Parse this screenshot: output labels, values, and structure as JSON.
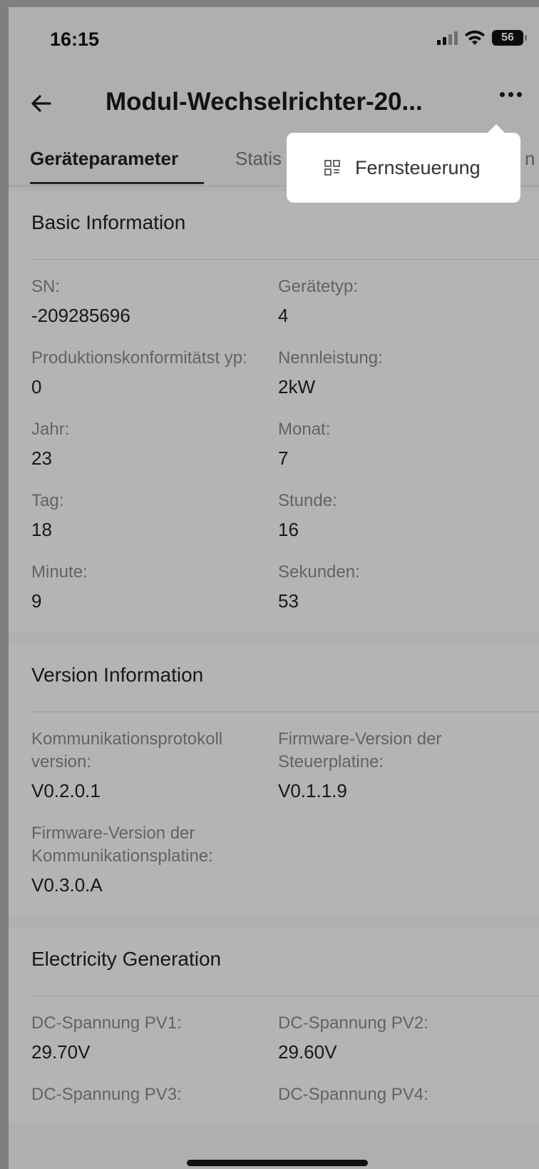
{
  "status": {
    "time": "16:15",
    "battery": "56"
  },
  "nav": {
    "title": "Modul-Wechselrichter-20..."
  },
  "tabs": [
    "Geräteparameter",
    "Statis",
    "n"
  ],
  "menu": {
    "item": "Fernsteuerung"
  },
  "sections": {
    "basic": {
      "title": "Basic Information",
      "fields": [
        {
          "label": "SN:",
          "value": "-209285696"
        },
        {
          "label": "Gerätetyp:",
          "value": "4"
        },
        {
          "label": "Produktionskonformitätst yp:",
          "value": "0"
        },
        {
          "label": "Nennleistung:",
          "value": "2kW"
        },
        {
          "label": "Jahr:",
          "value": "23"
        },
        {
          "label": "Monat:",
          "value": "7"
        },
        {
          "label": "Tag:",
          "value": "18"
        },
        {
          "label": "Stunde:",
          "value": "16"
        },
        {
          "label": "Minute:",
          "value": "9"
        },
        {
          "label": "Sekunden:",
          "value": "53"
        }
      ]
    },
    "version": {
      "title": "Version Information",
      "fields": [
        {
          "label": "Kommunikationsprotokoll version:",
          "value": "V0.2.0.1"
        },
        {
          "label": "Firmware-Version der Steuerplatine:",
          "value": "V0.1.1.9"
        },
        {
          "label": "Firmware-Version der Kommunikationsplatine:",
          "value": "V0.3.0.A"
        }
      ]
    },
    "electricity": {
      "title": "Electricity Generation",
      "fields": [
        {
          "label": "DC-Spannung PV1:",
          "value": "29.70V"
        },
        {
          "label": "DC-Spannung PV2:",
          "value": "29.60V"
        },
        {
          "label": "DC-Spannung PV3:",
          "value": ""
        },
        {
          "label": "DC-Spannung PV4:",
          "value": ""
        }
      ]
    }
  }
}
